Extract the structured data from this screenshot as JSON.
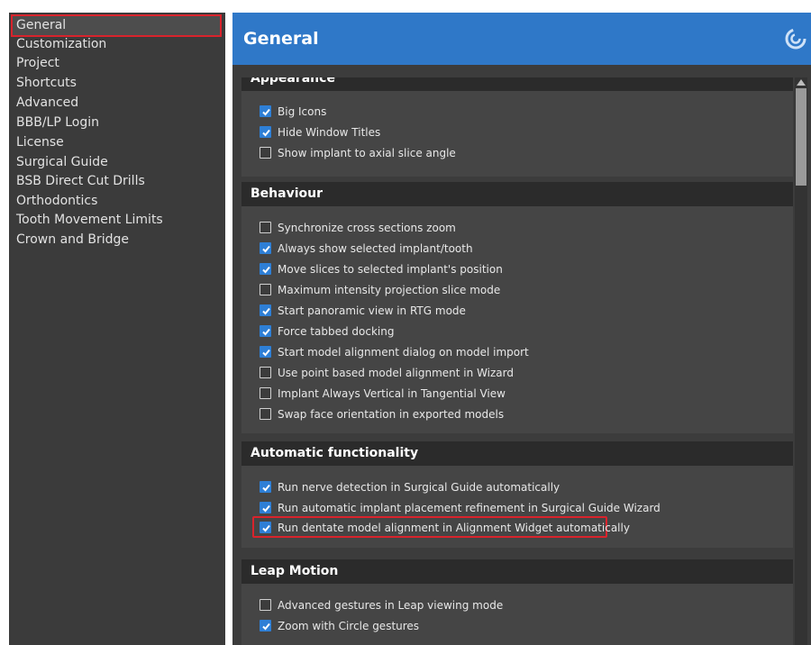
{
  "sidebar": {
    "items": [
      {
        "label": "General",
        "selected": true
      },
      {
        "label": "Customization"
      },
      {
        "label": "Project"
      },
      {
        "label": "Shortcuts"
      },
      {
        "label": "Advanced"
      },
      {
        "label": "BBB/LP Login"
      },
      {
        "label": "License"
      },
      {
        "label": "Surgical Guide"
      },
      {
        "label": "BSB Direct Cut Drills"
      },
      {
        "label": "Orthodontics"
      },
      {
        "label": "Tooth Movement Limits"
      },
      {
        "label": "Crown and Bridge"
      }
    ]
  },
  "header": {
    "title": "General"
  },
  "sections": [
    {
      "title": "Appearance",
      "options": [
        {
          "label": "Big Icons",
          "checked": true
        },
        {
          "label": "Hide Window Titles",
          "checked": true
        },
        {
          "label": "Show implant to axial slice angle",
          "checked": false
        }
      ]
    },
    {
      "title": "Behaviour",
      "options": [
        {
          "label": "Synchronize cross sections zoom",
          "checked": false
        },
        {
          "label": "Always show selected implant/tooth",
          "checked": true
        },
        {
          "label": "Move slices to selected implant's position",
          "checked": true
        },
        {
          "label": "Maximum intensity projection slice mode",
          "checked": false
        },
        {
          "label": "Start panoramic view in RTG mode",
          "checked": true
        },
        {
          "label": "Force tabbed docking",
          "checked": true
        },
        {
          "label": "Start model alignment dialog on model import",
          "checked": true
        },
        {
          "label": "Use point based model alignment in Wizard",
          "checked": false
        },
        {
          "label": "Implant Always Vertical in Tangential View",
          "checked": false
        },
        {
          "label": "Swap face orientation in exported models",
          "checked": false
        }
      ]
    },
    {
      "title": "Automatic functionality",
      "options": [
        {
          "label": "Run nerve detection in Surgical Guide automatically",
          "checked": true
        },
        {
          "label": "Run automatic implant placement refinement in Surgical Guide Wizard",
          "checked": true
        },
        {
          "label": "Run dentate model alignment in Alignment Widget automatically",
          "checked": true,
          "highlighted": true
        }
      ]
    },
    {
      "title": "Leap Motion",
      "options": [
        {
          "label": "Advanced gestures in Leap viewing mode",
          "checked": false
        },
        {
          "label": "Zoom with Circle gestures",
          "checked": true
        }
      ]
    }
  ],
  "colors": {
    "accent": "#2f78c8",
    "highlight_border": "#d9232c",
    "checkbox_on": "#2e7fd6"
  },
  "icons": {
    "logo": "swirl-logo-icon",
    "checkmark": "checkmark-icon"
  }
}
